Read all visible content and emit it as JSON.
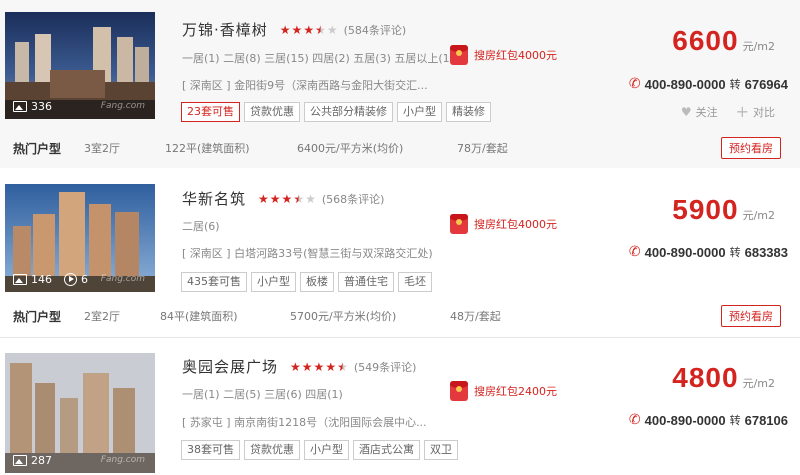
{
  "listings": [
    {
      "name": "万锦·香樟树",
      "rating": 3.5,
      "reviews": "(584条评论)",
      "layouts": "一居(1)  二居(8)  三居(15)  四居(2)  五居(3)  五居以上(1)",
      "address": "[ 深南区 ] 金阳街9号（深南西路与金阳大街交汇...",
      "tags": [
        {
          "label": "23套可售",
          "hot": true
        },
        {
          "label": "贷款优惠",
          "hot": false
        },
        {
          "label": "公共部分精装修",
          "hot": false
        },
        {
          "label": "小户型",
          "hot": false
        },
        {
          "label": "精装修",
          "hot": false
        }
      ],
      "photo_count": "336",
      "video_count": "",
      "hongbao": "搜房红包4000元",
      "price": "6600",
      "price_unit": "元/m2",
      "phone": "400-890-0000",
      "phone_zhuan": "转",
      "phone_ext": "676964",
      "follow": "关注",
      "compare": "对比",
      "hot": {
        "label": "热门户型",
        "layout": "3室2厅",
        "area": "122平(建筑面积)",
        "unit_price": "6400元/平方米(均价)",
        "total": "78万/套起",
        "button": "预约看房"
      }
    },
    {
      "name": "华新名筑",
      "rating": 3.5,
      "reviews": "(568条评论)",
      "layouts": "二居(6)",
      "address": "[ 深南区 ] 白塔河路33号(智慧三街与双深路交汇处)",
      "tags": [
        {
          "label": "435套可售",
          "hot": false
        },
        {
          "label": "小户型",
          "hot": false
        },
        {
          "label": "板楼",
          "hot": false
        },
        {
          "label": "普通住宅",
          "hot": false
        },
        {
          "label": "毛坯",
          "hot": false
        }
      ],
      "photo_count": "146",
      "video_count": "6",
      "hongbao": "搜房红包4000元",
      "price": "5900",
      "price_unit": "元/m2",
      "phone": "400-890-0000",
      "phone_zhuan": "转",
      "phone_ext": "683383",
      "hot": {
        "label": "热门户型",
        "layout": "2室2厅",
        "area": "84平(建筑面积)",
        "unit_price": "5700元/平方米(均价)",
        "total": "48万/套起",
        "button": "预约看房"
      }
    },
    {
      "name": "奥园会展广场",
      "rating": 4.5,
      "reviews": "(549条评论)",
      "layouts": "一居(1)  二居(5)  三居(6)  四居(1)",
      "address": "[ 苏家屯 ] 南京南街1218号（沈阳国际会展中心...",
      "tags": [
        {
          "label": "38套可售",
          "hot": false
        },
        {
          "label": "贷款优惠",
          "hot": false
        },
        {
          "label": "小户型",
          "hot": false
        },
        {
          "label": "酒店式公寓",
          "hot": false
        },
        {
          "label": "双卫",
          "hot": false
        }
      ],
      "photo_count": "287",
      "video_count": "",
      "hongbao": "搜房红包2400元",
      "price": "4800",
      "price_unit": "元/m2",
      "phone": "400-890-0000",
      "phone_zhuan": "转",
      "phone_ext": "678106"
    }
  ],
  "watermark": "Fang.com",
  "colors": {
    "accent": "#d4241f",
    "star_off": "#cccccc"
  },
  "icons": [
    "picture-icon",
    "video-icon",
    "star-icon",
    "hongbao-icon",
    "phone-icon",
    "heart-icon",
    "plus-icon"
  ]
}
